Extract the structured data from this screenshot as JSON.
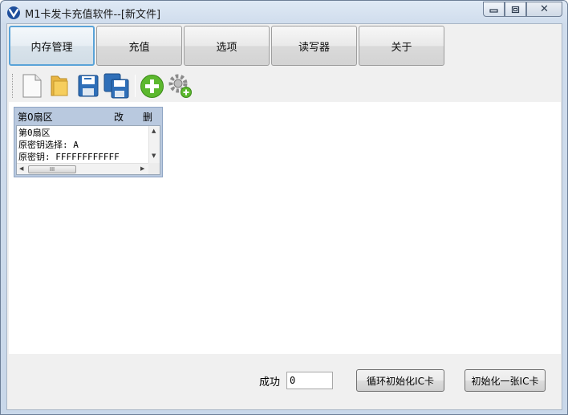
{
  "window": {
    "title": "M1卡发卡充值软件--[新文件]",
    "controls": {
      "minimize": "▭",
      "maximize": "▢",
      "close": "✕"
    }
  },
  "tabs": [
    {
      "label": "内存管理",
      "active": true
    },
    {
      "label": "充值",
      "active": false
    },
    {
      "label": "选项",
      "active": false
    },
    {
      "label": "读写器",
      "active": false
    },
    {
      "label": "关于",
      "active": false
    }
  ],
  "toolbar": {
    "buttons": [
      "new-file-icon",
      "open-folder-icon",
      "save-icon",
      "save-all-icon",
      "add-sector-icon",
      "settings-add-icon"
    ]
  },
  "sector_card": {
    "title": "第0扇区",
    "edit_label": "改",
    "delete_label": "删",
    "lines": [
      "第0扇区",
      "原密钥选择: A",
      "原密钥: FFFFFFFFFFFF"
    ],
    "hscroll_thumb": "III"
  },
  "footer": {
    "success_label": "成功",
    "success_value": "0",
    "loop_init_button": "循环初始化IC卡",
    "init_one_button": "初始化一张IC卡"
  },
  "colors": {
    "titlebar": "#dfe9f5",
    "active_tab_border": "#5aa3d8",
    "sector_header": "#b9c9df"
  }
}
